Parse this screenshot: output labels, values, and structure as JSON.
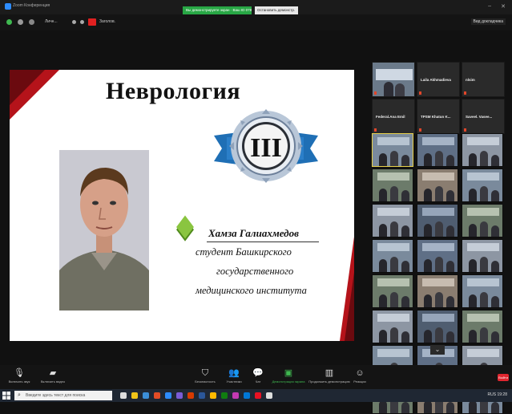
{
  "window": {
    "title": "Zoom Конференция",
    "share_banner": "Вы демонстрируете экран · Ваш ID 0789",
    "stop_share": "Остановить демонстр.",
    "view_button": "Вид докладчика"
  },
  "toolbar": {
    "item1": "Личн...",
    "item2": "Заголов."
  },
  "slide": {
    "title": "Неврология",
    "badge_numeral": "III",
    "presenter_name": "Хамза Галиахмедов",
    "desc_line1": "студент Башкирского",
    "desc_line2": "государственного",
    "desc_line3": "медицинского института"
  },
  "gallery": {
    "top_tiles": [
      {
        "name": "",
        "type": "video"
      },
      {
        "name": "Laila Akhmadieva",
        "type": "name"
      },
      {
        "name": "nlsim",
        "type": "name"
      },
      {
        "name": "Federal.Ana Emil",
        "type": "name"
      },
      {
        "name": "TPSM Khatun K...",
        "type": "name"
      },
      {
        "name": "Saveel. Vasee...",
        "type": "name"
      }
    ],
    "video_tile_count": 24
  },
  "controls": [
    {
      "label": "Включить звук",
      "icon": "mic-icon"
    },
    {
      "label": "Включить видео",
      "icon": "video-icon"
    },
    {
      "label": "Безопасность",
      "icon": "shield-icon"
    },
    {
      "label": "Участники",
      "icon": "participants-icon"
    },
    {
      "label": "Чат",
      "icon": "chat-icon"
    },
    {
      "label": "Демонстрация экрана",
      "icon": "share-icon"
    },
    {
      "label": "Продолжить демонстрацию",
      "icon": "pause-icon"
    },
    {
      "label": "Реакции",
      "icon": "reactions-icon"
    }
  ],
  "end_button": "Выйти",
  "taskbar": {
    "search_placeholder": "Введите здесь текст для поиска",
    "tray_text": "RUS 19:28"
  },
  "colors": {
    "accent_red": "#b5131a",
    "dark_red": "#6b0a0f",
    "share_green": "#28a745",
    "zoom_blue": "#2d8cff"
  }
}
